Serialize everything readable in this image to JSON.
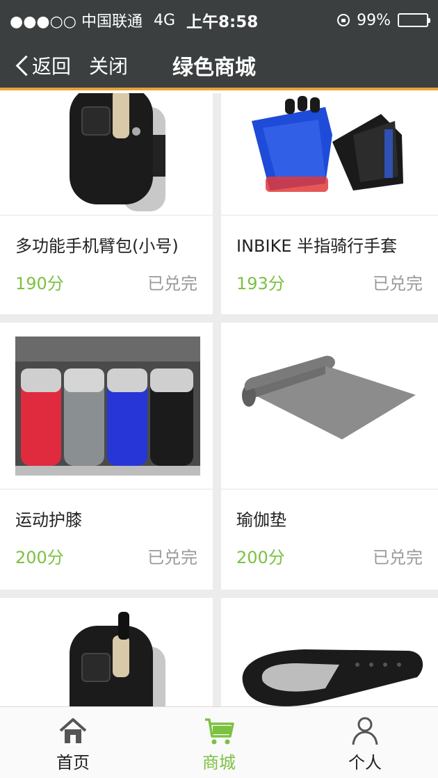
{
  "status_bar": {
    "carrier": "●●●○○ 中国联通",
    "network": "4G",
    "time": "上午8:58",
    "battery": "99%"
  },
  "nav": {
    "back_label": "返回",
    "close_label": "关闭",
    "title": "绿色商城"
  },
  "products": [
    {
      "name": "多功能手机臂包(小号)",
      "price": "190分",
      "status": "已兑完",
      "image_icon": "armband-icon"
    },
    {
      "name": "INBIKE 半指骑行手套",
      "price": "193分",
      "status": "已兑完",
      "image_icon": "gloves-icon"
    },
    {
      "name": "运动护膝",
      "price": "200分",
      "status": "已兑完",
      "image_icon": "knee-pads-icon"
    },
    {
      "name": "瑜伽垫",
      "price": "200分",
      "status": "已兑完",
      "image_icon": "yoga-mat-icon"
    },
    {
      "name": "",
      "price": "",
      "status": "",
      "image_icon": "armband-icon"
    },
    {
      "name": "",
      "price": "",
      "status": "",
      "image_icon": "fitness-band-icon"
    }
  ],
  "tabs": [
    {
      "label": "首页",
      "icon": "home-icon",
      "active": false
    },
    {
      "label": "商城",
      "icon": "cart-icon",
      "active": true
    },
    {
      "label": "个人",
      "icon": "person-icon",
      "active": false
    }
  ],
  "colors": {
    "header_bg": "#3b3f3f",
    "accent_line": "#e8a33b",
    "price_green": "#7cc142",
    "status_gray": "#999999"
  }
}
